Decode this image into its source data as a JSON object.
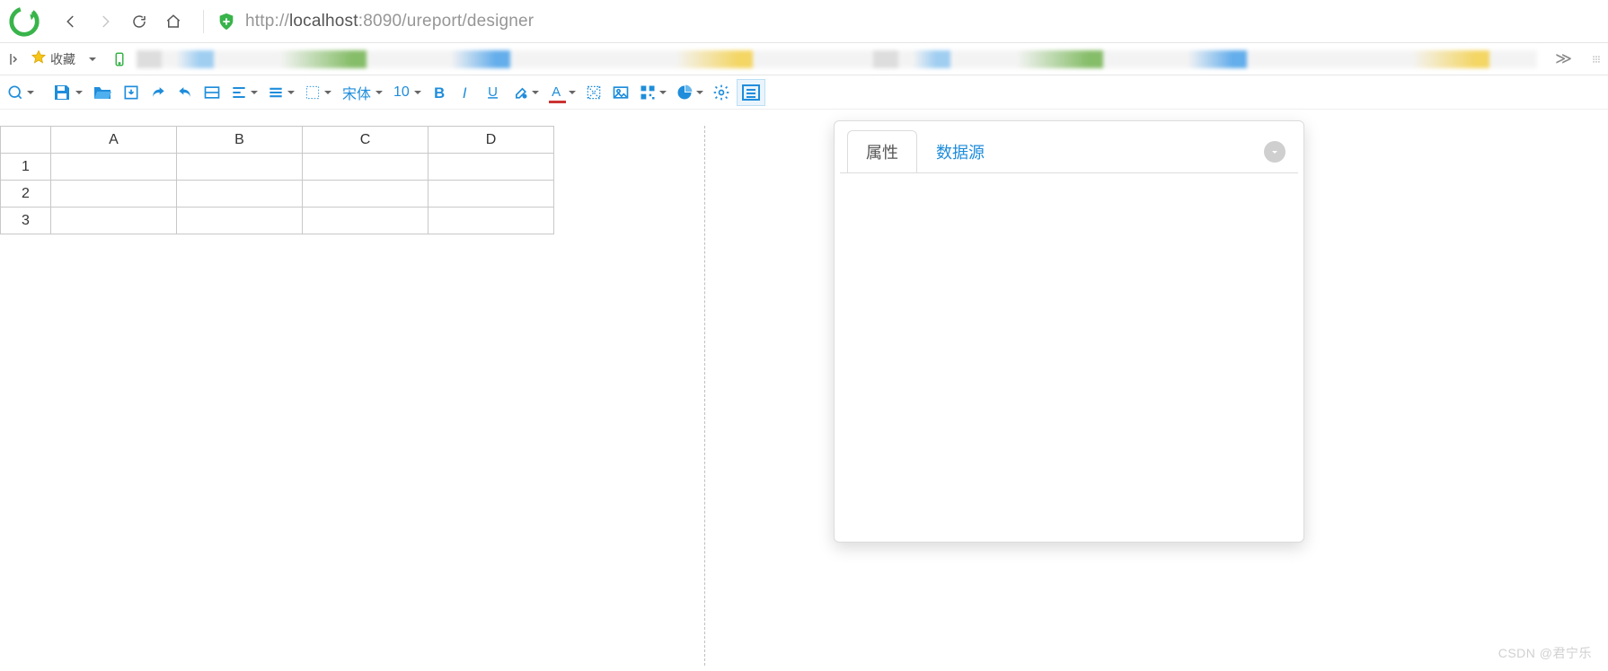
{
  "browser": {
    "url_pre": "http://",
    "url_host": "localhost",
    "url_rest": ":8090/ureport/designer"
  },
  "bookmarks": {
    "favorites_label": "收藏"
  },
  "toolbar": {
    "font_family": "宋体",
    "font_size": "10"
  },
  "sheet": {
    "columns": [
      "A",
      "B",
      "C",
      "D"
    ],
    "rows": [
      "1",
      "2",
      "3"
    ]
  },
  "panel": {
    "tab_properties": "属性",
    "tab_datasource": "数据源"
  },
  "watermark": "CSDN @君宁乐"
}
